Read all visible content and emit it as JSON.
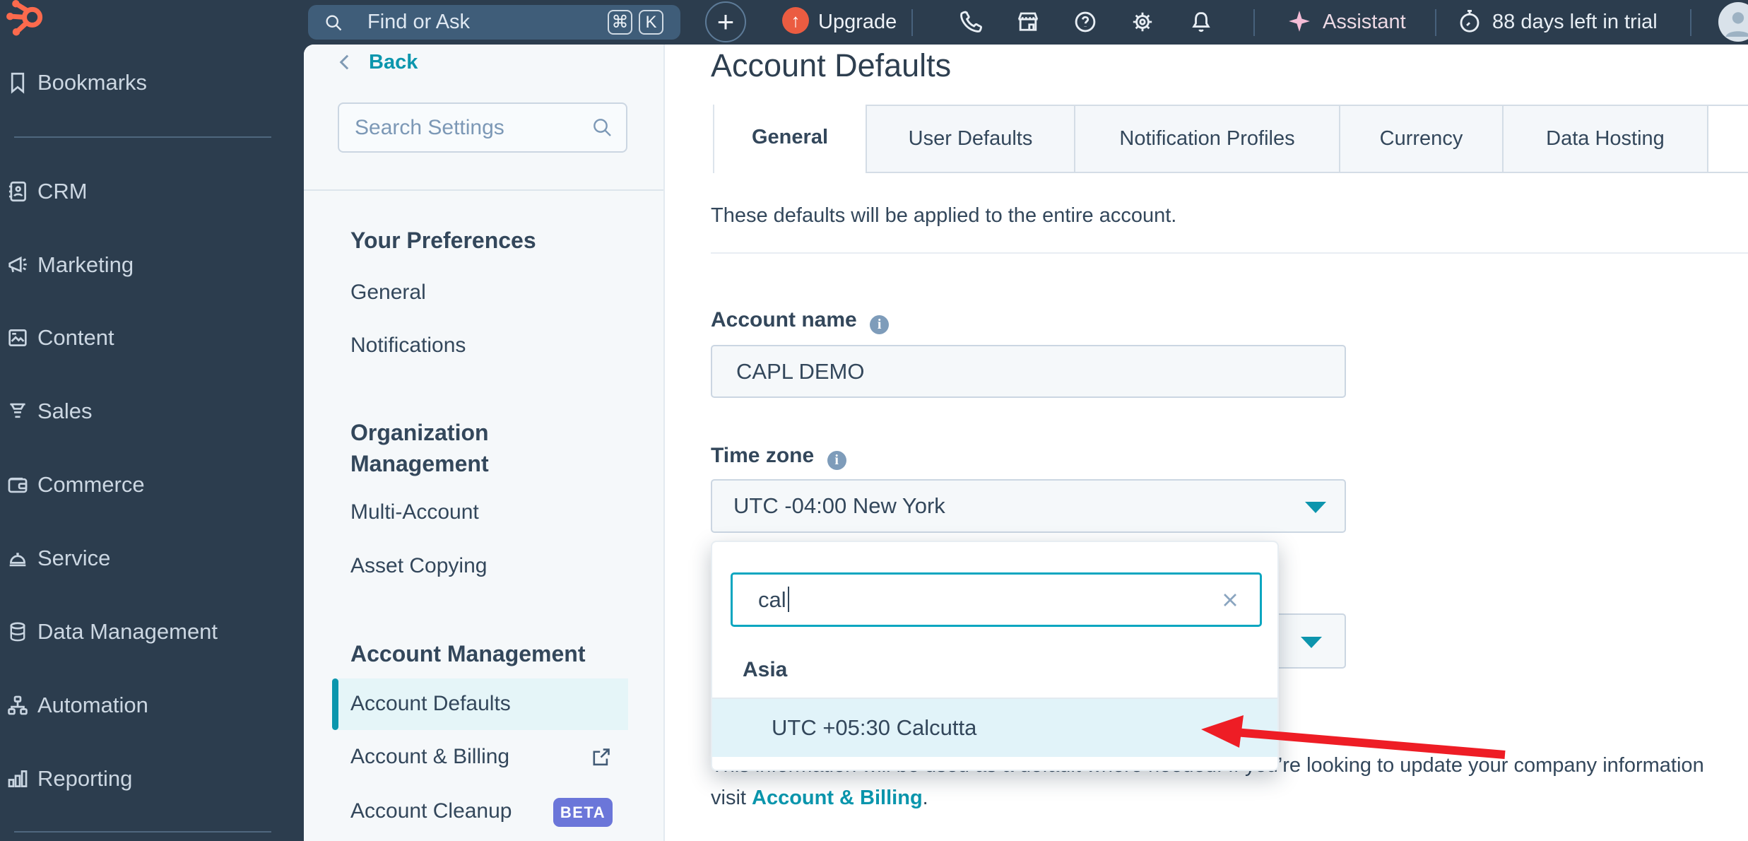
{
  "topbar": {
    "search": {
      "placeholder": "Find or Ask",
      "keys": [
        "⌘",
        "K"
      ]
    },
    "upgrade_label": "Upgrade",
    "assistant_label": "Assistant",
    "trial_label": "88 days left in trial"
  },
  "nav": {
    "items": [
      {
        "icon": "bookmark-icon",
        "label": "Bookmarks"
      },
      {
        "icon": "crm-icon",
        "label": "CRM"
      },
      {
        "icon": "megaphone-icon",
        "label": "Marketing"
      },
      {
        "icon": "content-icon",
        "label": "Content"
      },
      {
        "icon": "sales-icon",
        "label": "Sales"
      },
      {
        "icon": "commerce-icon",
        "label": "Commerce"
      },
      {
        "icon": "service-icon",
        "label": "Service"
      },
      {
        "icon": "database-icon",
        "label": "Data Management"
      },
      {
        "icon": "workflow-icon",
        "label": "Automation"
      },
      {
        "icon": "chart-icon",
        "label": "Reporting"
      }
    ]
  },
  "settings": {
    "back_label": "Back",
    "search_placeholder": "Search Settings",
    "sections": [
      {
        "heading": "Your Preferences",
        "items": [
          {
            "label": "General"
          },
          {
            "label": "Notifications"
          }
        ]
      },
      {
        "heading": "Organization Management",
        "items": [
          {
            "label": "Multi-Account"
          },
          {
            "label": "Asset Copying"
          }
        ]
      },
      {
        "heading": "Account Management",
        "items": [
          {
            "label": "Account Defaults"
          },
          {
            "label": "Account & Billing"
          },
          {
            "label": "Account Cleanup",
            "badge": "BETA"
          }
        ]
      }
    ]
  },
  "main": {
    "title": "Account Defaults",
    "tabs": [
      {
        "label": "General"
      },
      {
        "label": "User Defaults"
      },
      {
        "label": "Notification Profiles"
      },
      {
        "label": "Currency"
      },
      {
        "label": "Data Hosting"
      }
    ],
    "intro": "These defaults will be applied to the entire account.",
    "account_name": {
      "label": "Account name",
      "value": "CAPL DEMO"
    },
    "time_zone": {
      "label": "Time zone",
      "value": "UTC -04:00 New York"
    },
    "dropdown": {
      "search_value": "cal",
      "group_label": "Asia",
      "option_label": "UTC +05:30 Calcutta"
    },
    "footnote": {
      "line1": "This information will be used as a default where needed. If you’re looking to update your company information",
      "line2_prefix": "visit ",
      "link": "Account & Billing",
      "suffix": "."
    }
  },
  "colors": {
    "topbar_navy": "#2c3d4e",
    "accent_teal": "#0b96ad",
    "selected_bg": "#e5f5f8",
    "beta_badge": "#6b76d9",
    "arrow_red": "#ee1d25",
    "upgrade_orange": "#eb5c41",
    "logo_orange": "#fc6a4d"
  }
}
